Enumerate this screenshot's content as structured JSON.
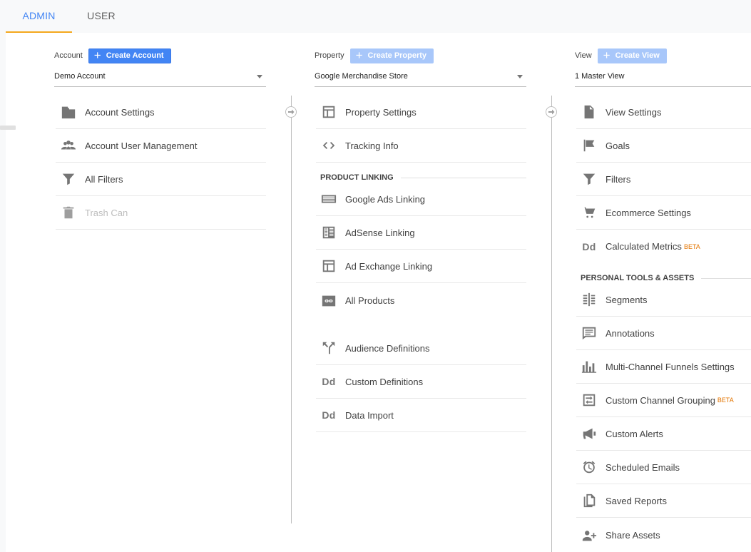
{
  "tabs": {
    "admin": "ADMIN",
    "user": "USER"
  },
  "account": {
    "label": "Account",
    "create": "Create Account",
    "selected": "Demo Account",
    "items": [
      {
        "label": "Account Settings"
      },
      {
        "label": "Account User Management"
      },
      {
        "label": "All Filters"
      },
      {
        "label": "Trash Can"
      }
    ]
  },
  "property": {
    "label": "Property",
    "create": "Create Property",
    "selected": "Google Merchandise Store",
    "items": [
      {
        "label": "Property Settings"
      },
      {
        "label": "Tracking Info"
      },
      {
        "label": "Google Ads Linking"
      },
      {
        "label": "AdSense Linking"
      },
      {
        "label": "Ad Exchange Linking"
      },
      {
        "label": "All Products"
      },
      {
        "label": "Audience Definitions"
      },
      {
        "label": "Custom Definitions"
      },
      {
        "label": "Data Import"
      }
    ],
    "section": "PRODUCT LINKING",
    "dd_icon": "Dd"
  },
  "view": {
    "label": "View",
    "create": "Create View",
    "selected": "1 Master View",
    "items": [
      {
        "label": "View Settings"
      },
      {
        "label": "Goals"
      },
      {
        "label": "Filters"
      },
      {
        "label": "Ecommerce Settings"
      },
      {
        "label": "Calculated Metrics"
      },
      {
        "label": "Segments"
      },
      {
        "label": "Annotations"
      },
      {
        "label": "Multi-Channel Funnels Settings"
      },
      {
        "label": "Custom Channel Grouping"
      },
      {
        "label": "Custom Alerts"
      },
      {
        "label": "Scheduled Emails"
      },
      {
        "label": "Saved Reports"
      },
      {
        "label": "Share Assets"
      }
    ],
    "section": "PERSONAL TOOLS & ASSETS",
    "beta": "BETA",
    "dd_icon": "Dd"
  },
  "colors": {
    "accent": "#4285f4",
    "tab_indicator": "#f4a81d",
    "beta": "#e37400"
  }
}
